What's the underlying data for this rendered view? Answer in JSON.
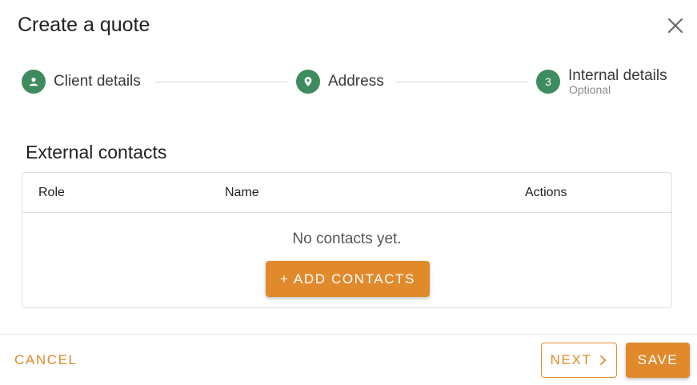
{
  "dialog": {
    "title": "Create a quote",
    "close_icon": "close-icon"
  },
  "stepper": {
    "steps": [
      {
        "label": "Client details",
        "icon": "person-icon",
        "sub": ""
      },
      {
        "label": "Address",
        "icon": "location-pin-icon",
        "sub": ""
      },
      {
        "label": "Internal details",
        "number": "3",
        "sub": "Optional"
      }
    ],
    "step_color": "#3d8b5e"
  },
  "external_contacts": {
    "title": "External contacts",
    "columns": [
      "Role",
      "Name",
      "Actions"
    ],
    "empty_text": "No contacts yet.",
    "add_button": "+ ADD CONTACTS"
  },
  "footer": {
    "cancel": "CANCEL",
    "next": "NEXT",
    "save": "SAVE"
  },
  "colors": {
    "accent": "#e08a2c",
    "step_green": "#3d8b5e"
  }
}
